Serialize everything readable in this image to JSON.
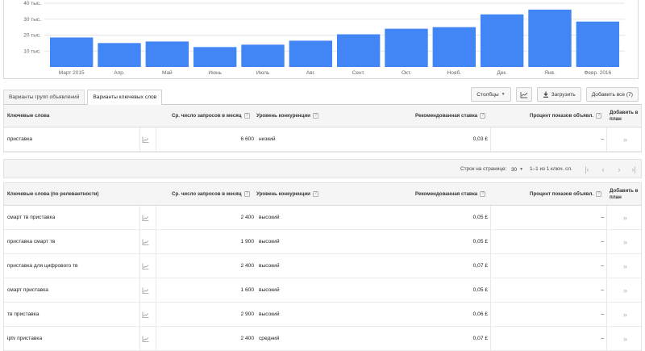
{
  "chart_data": {
    "type": "bar",
    "categories": [
      "Март 2015",
      "Апр.",
      "Май",
      "Июнь",
      "Июль",
      "Авг.",
      "Сент.",
      "Окт.",
      "Нояб.",
      "Дек.",
      "Янв.",
      "Февр. 2016"
    ],
    "values": [
      18.5,
      15,
      16,
      12.5,
      14,
      16.5,
      20.5,
      24,
      25,
      33,
      36,
      28.5
    ],
    "y_ticks": [
      "10 тыс.",
      "20 тыс.",
      "30 тыс.",
      "40 тыс."
    ],
    "y_tick_values": [
      10,
      20,
      30,
      40
    ],
    "ylim": [
      0,
      40
    ],
    "bar_color": "#4285f4",
    "grid": true
  },
  "tabs": [
    {
      "label": "Варианты групп объявлений",
      "active": false
    },
    {
      "label": "Варианты ключевых слов",
      "active": true
    }
  ],
  "toolbar": {
    "columns_label": "Столбцы",
    "download_label": "Загрузить",
    "add_all_label": "Добавить все (7)"
  },
  "columns": {
    "keyword": "Ключевые слова",
    "keyword_relevance": "Ключевые слова (по релевантности)",
    "avg_searches": "Ср. число запросов в месяц",
    "competition": "Уровень конкуренции",
    "suggested_bid": "Рекомендованная ставка",
    "impression_share": "Процент показов объявл.",
    "add_to_plan": "Добавить в план"
  },
  "searched_keywords": [
    {
      "keyword": "приставка",
      "searches": "6 600",
      "competition": "низкий",
      "bid": "0,03 £",
      "share": "–"
    }
  ],
  "pager": {
    "rows_label": "Строк на странице:",
    "rows_value": "30",
    "range": "1–1 из 1 ключ. сл."
  },
  "keyword_ideas": [
    {
      "keyword": "смарт тв приставка",
      "searches": "2 400",
      "competition": "высокий",
      "bid": "0,05 £",
      "share": "–"
    },
    {
      "keyword": "приставка смарт тв",
      "searches": "1 900",
      "competition": "высокий",
      "bid": "0,05 £",
      "share": "–"
    },
    {
      "keyword": "приставка для цифрового тв",
      "searches": "2 400",
      "competition": "высокий",
      "bid": "0,07 £",
      "share": "–"
    },
    {
      "keyword": "смарт приставка",
      "searches": "1 600",
      "competition": "высокий",
      "bid": "0,05 £",
      "share": "–"
    },
    {
      "keyword": "тв приставка",
      "searches": "2 900",
      "competition": "высокий",
      "bid": "0,06 £",
      "share": "–"
    },
    {
      "keyword": "iptv приставка",
      "searches": "2 400",
      "competition": "средний",
      "bid": "0,07 £",
      "share": "–"
    }
  ]
}
